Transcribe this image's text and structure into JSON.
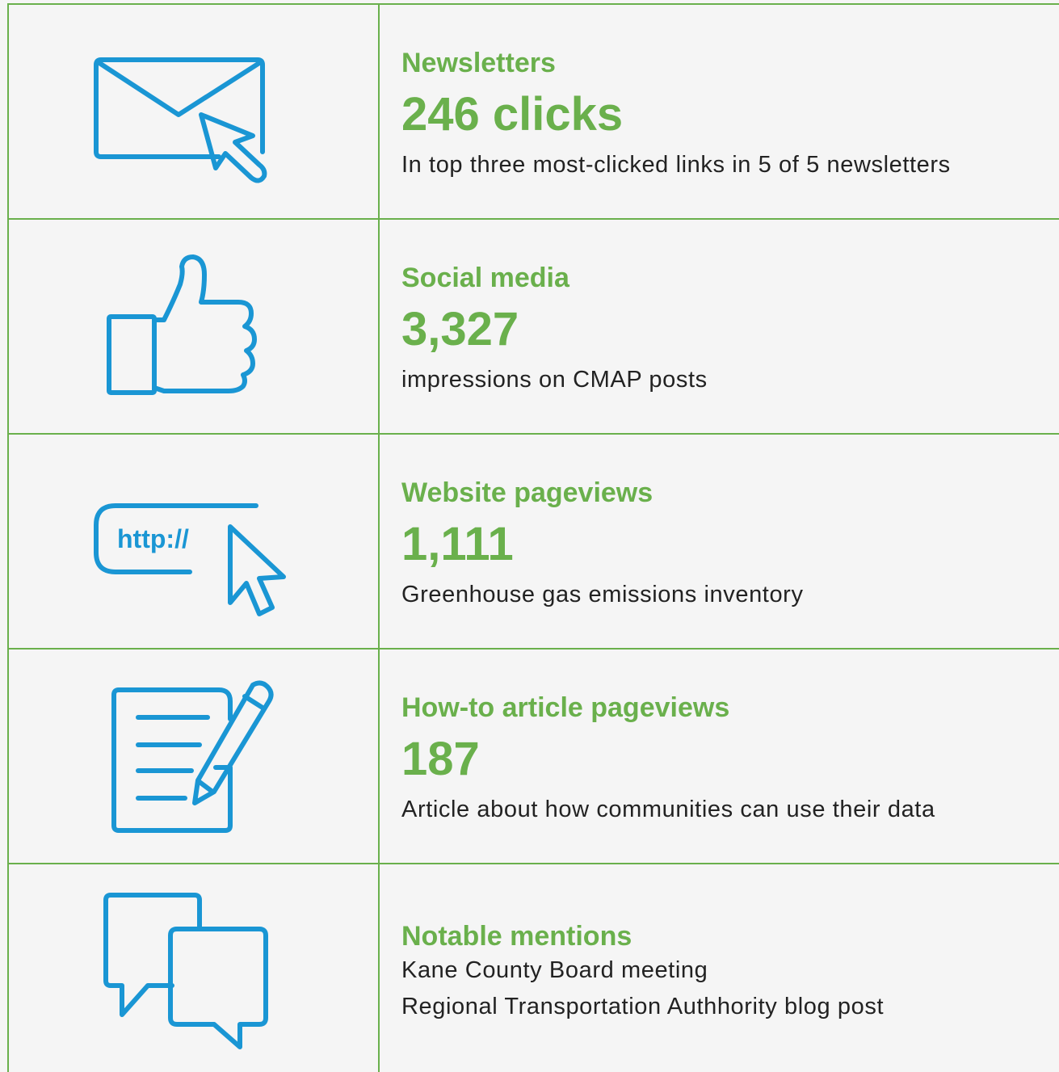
{
  "colors": {
    "accent_green": "#6ab04c",
    "icon_blue": "#1a96d4",
    "text_dark": "#222222",
    "background": "#f5f5f5"
  },
  "rows": [
    {
      "icon": "envelope-cursor-icon",
      "heading": "Newsletters",
      "value": "246 clicks",
      "description": "In top three most-clicked links in 5 of 5 newsletters"
    },
    {
      "icon": "thumbs-up-icon",
      "heading": "Social media",
      "value": "3,327",
      "description": "impressions on CMAP posts"
    },
    {
      "icon": "url-cursor-icon",
      "icon_text": "http://",
      "heading": "Website pageviews",
      "value": "1,111",
      "description": "Greenhouse gas emissions inventory"
    },
    {
      "icon": "document-pencil-icon",
      "heading": "How-to article pageviews",
      "value": "187",
      "description": "Article about how communities can use their data"
    },
    {
      "icon": "speech-bubbles-icon",
      "heading": "Notable mentions",
      "mentions": [
        "Kane County Board meeting",
        "Regional Transportation Authhority blog post"
      ]
    }
  ]
}
